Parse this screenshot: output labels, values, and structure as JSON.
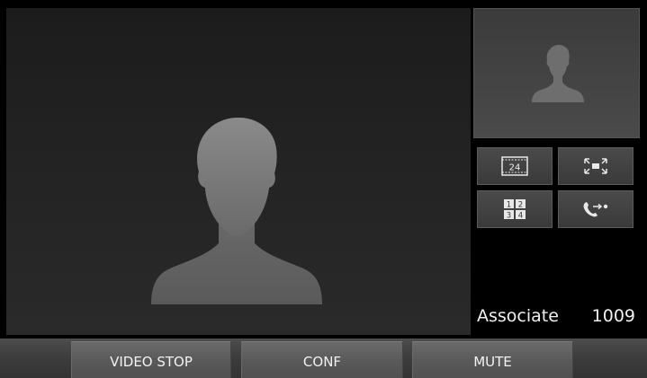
{
  "call": {
    "caller_name": "Associate",
    "caller_extension": "1009"
  },
  "controls": {
    "fps_label": "24",
    "dialpad_digits": [
      "1",
      "2",
      "3",
      "4"
    ]
  },
  "softkeys": {
    "video_stop": "VIDEO STOP",
    "conf": "CONF",
    "mute": "MUTE"
  },
  "icons": {
    "remote_video": "person-silhouette-icon",
    "local_video": "person-silhouette-icon",
    "fps": "film-frame-icon",
    "fullscreen": "fullscreen-arrows-icon",
    "dialpad": "dialpad-icon",
    "transfer": "call-transfer-icon"
  },
  "colors": {
    "background": "#000000",
    "video_bg": "#222222",
    "pip_bg": "#444444",
    "button_bg": "#444444",
    "softkey_bg": "#5a5a5a",
    "text": "#f0f0f0"
  }
}
